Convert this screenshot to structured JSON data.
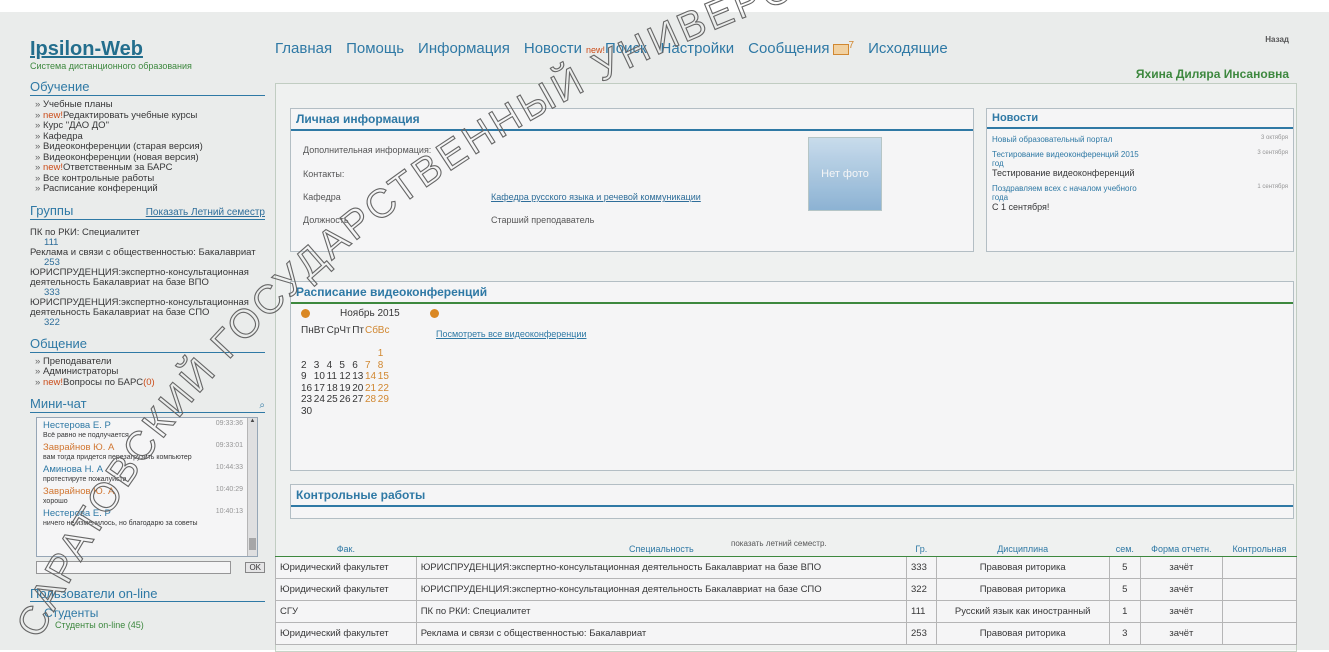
{
  "logo": {
    "title": "Ipsilon-Web",
    "subtitle": "Система дистанционного образования"
  },
  "sidebar": {
    "education": {
      "title": "Обучение",
      "items": [
        {
          "new": "",
          "label": "Учебные планы"
        },
        {
          "new": "new!",
          "label": "Редактировать учебные курсы"
        },
        {
          "new": "",
          "label": "Курс \"ДАО ДО\""
        },
        {
          "new": "",
          "label": "Кафедра"
        },
        {
          "new": "",
          "label": "Видеоконференции (старая версия)"
        },
        {
          "new": "",
          "label": "Видеоконференции (новая версия)"
        },
        {
          "new": "new!",
          "label": "Ответственным за БАРС"
        },
        {
          "new": "",
          "label": "Все контрольные работы"
        },
        {
          "new": "",
          "label": "Расписание конференций"
        }
      ]
    },
    "groups": {
      "title": "Группы",
      "summer_link": "Показать Летний семестр",
      "items": [
        {
          "name": "ПК по РКИ: Специалитет",
          "num": "111"
        },
        {
          "name": "Реклама и связи с общественностью: Бакалавриат",
          "num": "253"
        },
        {
          "name": "ЮРИСПРУДЕНЦИЯ:экспертно-консультационная деятельность Бакалавриат на базе ВПО",
          "num": "333"
        },
        {
          "name": "ЮРИСПРУДЕНЦИЯ:экспертно-консультационная деятельность Бакалавриат на базе СПО",
          "num": "322"
        }
      ]
    },
    "communication": {
      "title": "Общение",
      "items": [
        {
          "new": "",
          "label": "Преподаватели",
          "suffix": ""
        },
        {
          "new": "",
          "label": "Администраторы",
          "suffix": ""
        },
        {
          "new": "new!",
          "label": "Вопросы по БАРС",
          "suffix": "(0)"
        }
      ]
    },
    "chat": {
      "title": "Мини-чат",
      "messages": [
        {
          "name": "Нестерова Е. Р",
          "time": "09:33:36",
          "text": "Всё равно не подлучается",
          "orange": false
        },
        {
          "name": "Заврайнов Ю. А",
          "time": "09:33:01",
          "text": "вам тогда придется перезагрузить компьютер",
          "orange": true
        },
        {
          "name": "Аминова Н. А",
          "time": "10:44:33",
          "text": "протестируте пожалуйста",
          "orange": false
        },
        {
          "name": "Заврайнов Ю. А",
          "time": "10:40:29",
          "text": "хорошо",
          "orange": true
        },
        {
          "name": "Нестерова Е. Р",
          "time": "10:40:13",
          "text": "ничего не изменилось, но благодарю за советы",
          "orange": false
        }
      ],
      "ok_label": "OK"
    },
    "online": {
      "title": "Пользователи on-line",
      "students": "Студенты",
      "students_online": "Студенты on-line (45)"
    }
  },
  "topnav": {
    "items": [
      "Главная",
      "Помощь",
      "Информация",
      "Новости"
    ],
    "new_badge": "new!",
    "search": "Поиск",
    "settings": "Настройки",
    "messages": "Сообщения",
    "messages_count": "7",
    "outgoing": "Исходящие",
    "back": "Назад",
    "username": "Яхина Диляра Инсановна"
  },
  "personal": {
    "title": "Личная информация",
    "additional_label": "Дополнительная информация:",
    "contacts_label": "Контакты:",
    "dept_label": "Кафедра",
    "dept_value": "Кафедра русского языка и речевой коммуникации",
    "position_label": "Должность",
    "position_value": "Старший преподаватель",
    "photo_text": "Нет фото"
  },
  "news": {
    "title": "Новости",
    "items": [
      {
        "link": "Новый образовательный портал",
        "date": "3 октября",
        "text": ""
      },
      {
        "link": "Тестирование видеоконференций 2015 год",
        "date": "3 сентября",
        "text": "Тестирование видеоконференций"
      },
      {
        "link": "Поздравляем всех с началом учебного года",
        "date": "1 сентября",
        "text": "С 1 сентября!"
      }
    ]
  },
  "schedule": {
    "title": "Расписание видеоконференций",
    "month": "Ноябрь 2015",
    "view_all": "Посмотреть все видеоконференции",
    "weekdays": [
      "Пн",
      "Вт",
      "Ср",
      "Чт",
      "Пт",
      "Сб",
      "Вс"
    ],
    "weeks": [
      [
        "",
        "",
        "",
        "",
        "",
        "",
        "1"
      ],
      [
        "2",
        "3",
        "4",
        "5",
        "6",
        "7",
        "8"
      ],
      [
        "9",
        "10",
        "11",
        "12",
        "13",
        "14",
        "15"
      ],
      [
        "16",
        "17",
        "18",
        "19",
        "20",
        "21",
        "22"
      ],
      [
        "23",
        "24",
        "25",
        "26",
        "27",
        "28",
        "29"
      ],
      [
        "30",
        "",
        "",
        "",
        "",
        "",
        ""
      ]
    ]
  },
  "works": {
    "title": "Контрольные работы",
    "show_summer": "показать летний семестр.",
    "headers": [
      "Фак.",
      "Специальность",
      "Гр.",
      "Дисциплина",
      "сем.",
      "Форма отчетн.",
      "Контрольная"
    ],
    "rows": [
      [
        "Юридический факультет",
        "ЮРИСПРУДЕНЦИЯ:экспертно-консультационная деятельность Бакалавриат на базе ВПО",
        "333",
        "Правовая риторика",
        "5",
        "зачёт",
        ""
      ],
      [
        "Юридический факультет",
        "ЮРИСПРУДЕНЦИЯ:экспертно-консультационная деятельность Бакалавриат на базе СПО",
        "322",
        "Правовая риторика",
        "5",
        "зачёт",
        ""
      ],
      [
        "СГУ",
        "ПК по РКИ: Специалитет",
        "111",
        "Русский язык как иностранный",
        "1",
        "зачёт",
        ""
      ],
      [
        "Юридический факультет",
        "Реклама и связи с общественностью: Бакалавриат",
        "253",
        "Правовая риторика",
        "3",
        "зачёт",
        ""
      ]
    ]
  },
  "watermark": {
    "text": "САРАТОВСКИЙ ГОСУДАРСТВЕННЫЙ УНИВЕРСИТЕТ"
  }
}
